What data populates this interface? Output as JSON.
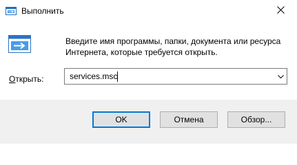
{
  "window": {
    "title": "Выполнить",
    "app_icon": "run-app-icon",
    "close_icon": "close-icon"
  },
  "content": {
    "icon": "run-program-icon",
    "description": "Введите имя программы, папки, документа или ресурса Интернета, которые требуется открыть."
  },
  "open_field": {
    "label_underlined": "О",
    "label_rest": "ткрыть:",
    "value": "services.msc",
    "dropdown_icon": "chevron-down-icon"
  },
  "buttons": {
    "ok": "OK",
    "cancel": "Отмена",
    "browse": "Обзор..."
  },
  "colors": {
    "accent": "#0078d7",
    "footer_bg": "#f0f0f0",
    "button_bg": "#e1e1e1"
  }
}
